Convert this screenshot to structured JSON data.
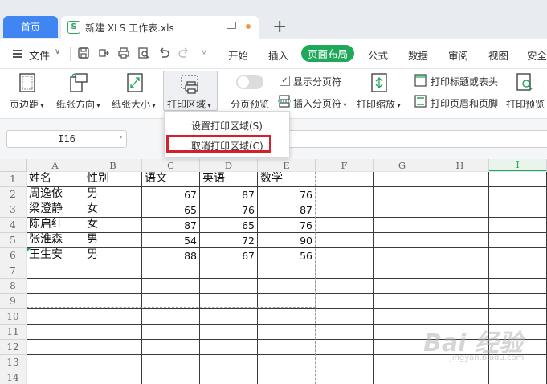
{
  "tabs": {
    "home": "首页",
    "document_title": "新建 XLS 工作表.xls",
    "doc_icon_letter": "S",
    "new_tab_symbol": "+"
  },
  "menubar": {
    "file_label": "文件",
    "items": [
      "开始",
      "插入",
      "页面布局",
      "公式",
      "数据",
      "审阅",
      "视图",
      "安全"
    ],
    "active_item": "页面布局"
  },
  "ribbon": {
    "margins": "页边距",
    "orientation": "纸张方向",
    "size": "纸张大小",
    "print_area": "打印区域",
    "page_break_preview": "分页预览",
    "show_page_breaks": "显示分页符",
    "show_page_breaks_checked": true,
    "insert_page_break": "插入分页符",
    "print_scaling": "打印缩放",
    "print_titles": "打印标题或表头",
    "print_header_footer": "打印页眉和页脚",
    "print_preview": "打印预览"
  },
  "print_area_menu": {
    "set": "设置打印区域(S)",
    "cancel": "取消打印区域(C)",
    "highlighted": "取消打印区域(C)"
  },
  "formula_bar": {
    "name_box": "I16"
  },
  "sheet": {
    "columns": [
      "A",
      "B",
      "C",
      "D",
      "E",
      "F",
      "G",
      "H",
      "I"
    ],
    "selected_column": "I",
    "rows": [
      "1",
      "2",
      "3",
      "4",
      "5",
      "6",
      "7",
      "8",
      "9",
      "10",
      "11",
      "12",
      "13",
      "14"
    ],
    "header": [
      "姓名",
      "性别",
      "语文",
      "英语",
      "数学"
    ],
    "data": [
      [
        "周逸依",
        "男",
        "67",
        "87",
        "76"
      ],
      [
        "梁澄静",
        "女",
        "65",
        "76",
        "87"
      ],
      [
        "陈启红",
        "女",
        "87",
        "65",
        "76"
      ],
      [
        "张淮森",
        "男",
        "54",
        "72",
        "90"
      ],
      [
        "王生安",
        "男",
        "88",
        "67",
        "56"
      ]
    ]
  },
  "colors": {
    "accent_green": "#1fa85a",
    "home_tab_blue": "#3f86f3",
    "highlight_red": "#d4202a"
  }
}
